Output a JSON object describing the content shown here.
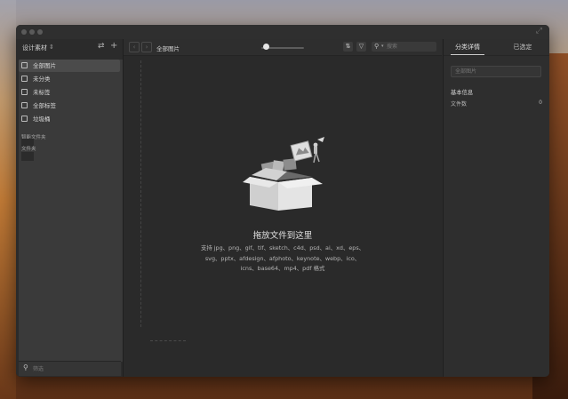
{
  "sidebar": {
    "library_name": "设计素材",
    "items": [
      {
        "label": "全部图片",
        "active": true
      },
      {
        "label": "未分类",
        "active": false
      },
      {
        "label": "未标签",
        "active": false
      },
      {
        "label": "全部标签",
        "active": false
      },
      {
        "label": "垃圾桶",
        "active": false
      }
    ],
    "section_smart": "智能文件夹",
    "section_folders": "文件夹",
    "filter_placeholder": "筛选"
  },
  "toolbar": {
    "view_title": "全部图片",
    "search_placeholder": "搜索"
  },
  "main": {
    "drop_title": "拖放文件到这里",
    "drop_subtitle": "支持 jpg、png、gif、tif、sketch、c4d、psd、ai、xd、eps、svg、pptx、afdesign、afphoto、keynote、webp、ico、icns、base64、mp4、pdf 格式"
  },
  "right_panel": {
    "tabs": [
      "分类详情",
      "已选定"
    ],
    "name_placeholder": "全部图片",
    "info_header": "基本信息",
    "file_count_label": "文件数",
    "file_count_value": "0"
  },
  "colors": {
    "window_bg": "#2c2c2c",
    "sidebar_list_bg": "#3a3a3a",
    "active_item_bg": "#4b4b4b",
    "text": "#d8d8d8"
  }
}
